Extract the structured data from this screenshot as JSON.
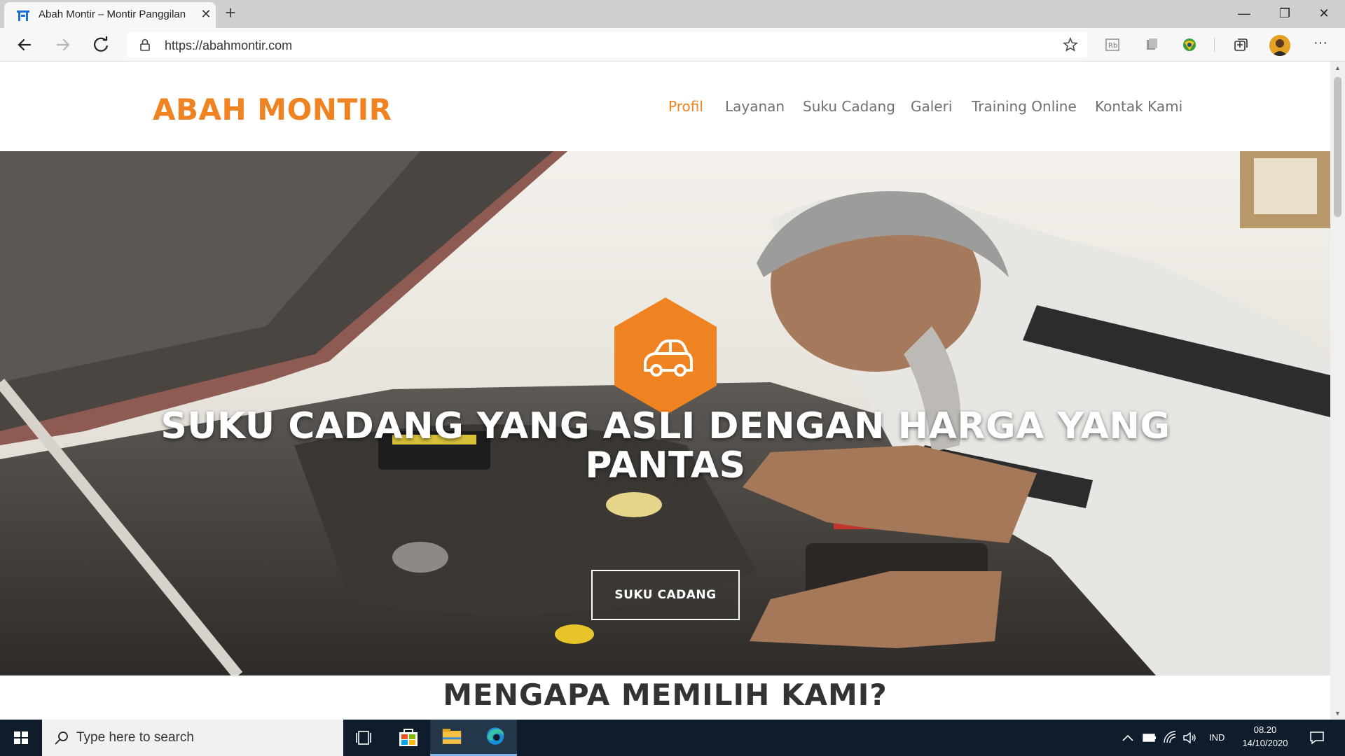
{
  "browser": {
    "tab_title": "Abah Montir – Montir Panggilan",
    "tab_close": "✕",
    "new_tab": "+",
    "url": "https://abahmontir.com",
    "more_label": "···",
    "window_controls": {
      "minimize": "—",
      "restore": "❐",
      "close": "✕"
    }
  },
  "site": {
    "logo": "ABAH MONTIR",
    "accent_color": "#f08321",
    "nav": [
      {
        "label": "Profil",
        "active": true
      },
      {
        "label": "Layanan",
        "active": false
      },
      {
        "label": "Suku Cadang",
        "active": false
      },
      {
        "label": "Galeri",
        "active": false
      },
      {
        "label": "Training Online",
        "active": false
      },
      {
        "label": "Kontak Kami",
        "active": false
      }
    ],
    "hero": {
      "icon": "car-icon",
      "title_line1": "SUKU CADANG YANG ASLI DENGAN HARGA YANG",
      "title_line2": "PANTAS",
      "button_label": "SUKU CADANG"
    },
    "section_title": "MENGAPA MEMILIH KAMI?"
  },
  "taskbar": {
    "search_placeholder": "Type here to search",
    "language": "IND",
    "time": "08.20",
    "date": "14/10/2020"
  }
}
